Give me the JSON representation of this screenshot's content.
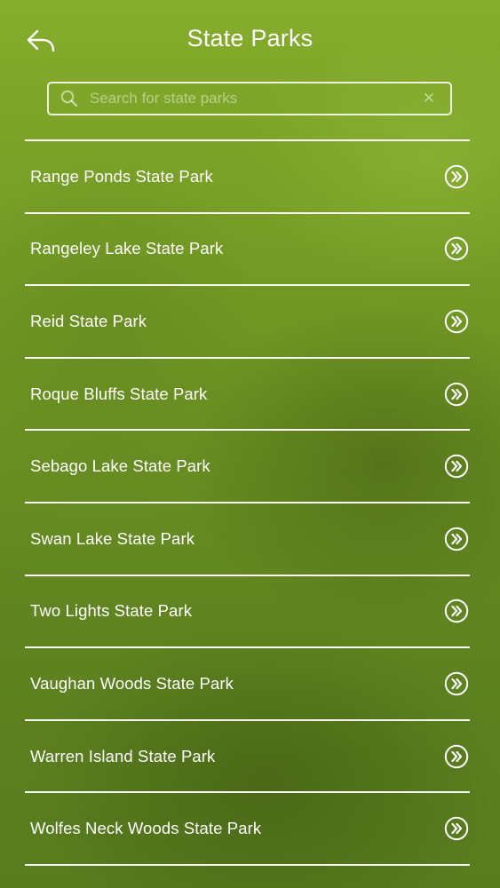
{
  "header": {
    "title": "State Parks",
    "back_icon": "back-arrow-icon"
  },
  "search": {
    "placeholder": "Search for state parks",
    "value": "",
    "search_icon": "search-icon",
    "clear_icon": "close-icon",
    "clear_symbol": "✕"
  },
  "list": {
    "row_icon": "double-chevron-right-circle-icon",
    "items": [
      {
        "label": "Range Ponds State Park"
      },
      {
        "label": "Rangeley Lake State Park"
      },
      {
        "label": "Reid State Park"
      },
      {
        "label": "Roque Bluffs State Park"
      },
      {
        "label": "Sebago Lake State Park"
      },
      {
        "label": "Swan Lake State Park"
      },
      {
        "label": "Two Lights State Park"
      },
      {
        "label": "Vaughan Woods State Park"
      },
      {
        "label": "Warren Island State Park"
      },
      {
        "label": "Wolfes Neck Woods State Park"
      }
    ]
  },
  "colors": {
    "background": "#6c9223",
    "foreground": "#ffffff"
  }
}
